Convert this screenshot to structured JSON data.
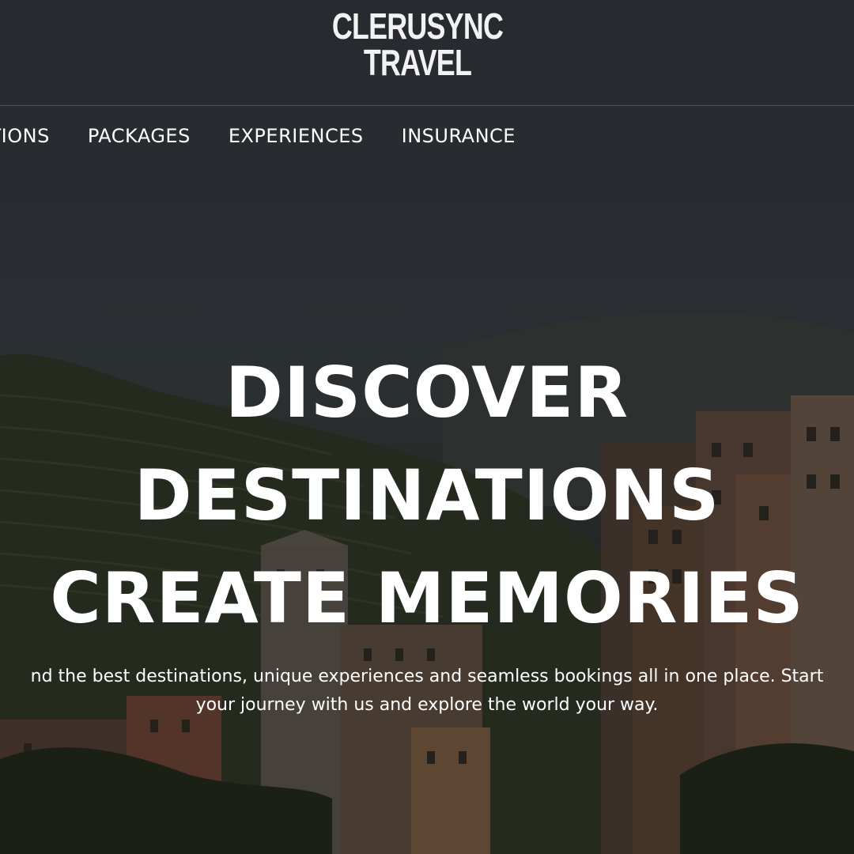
{
  "brand": {
    "line1": "CLERUSYNC",
    "line2": "TRAVEL"
  },
  "nav": {
    "items": [
      {
        "label": "NATIONS"
      },
      {
        "label": "PACKAGES"
      },
      {
        "label": "EXPERIENCES"
      },
      {
        "label": "INSURANCE"
      }
    ]
  },
  "hero": {
    "title_lines": [
      "DISCOVER",
      "DESTINATIONS",
      "CREATE MEMORIES"
    ],
    "subtitle_lines": [
      "nd the best destinations, unique experiences and seamless bookings all in one place. Start",
      "your journey with us and explore the world your way."
    ]
  },
  "colors": {
    "text": "#ffffff",
    "overlay": "#2b3036"
  }
}
